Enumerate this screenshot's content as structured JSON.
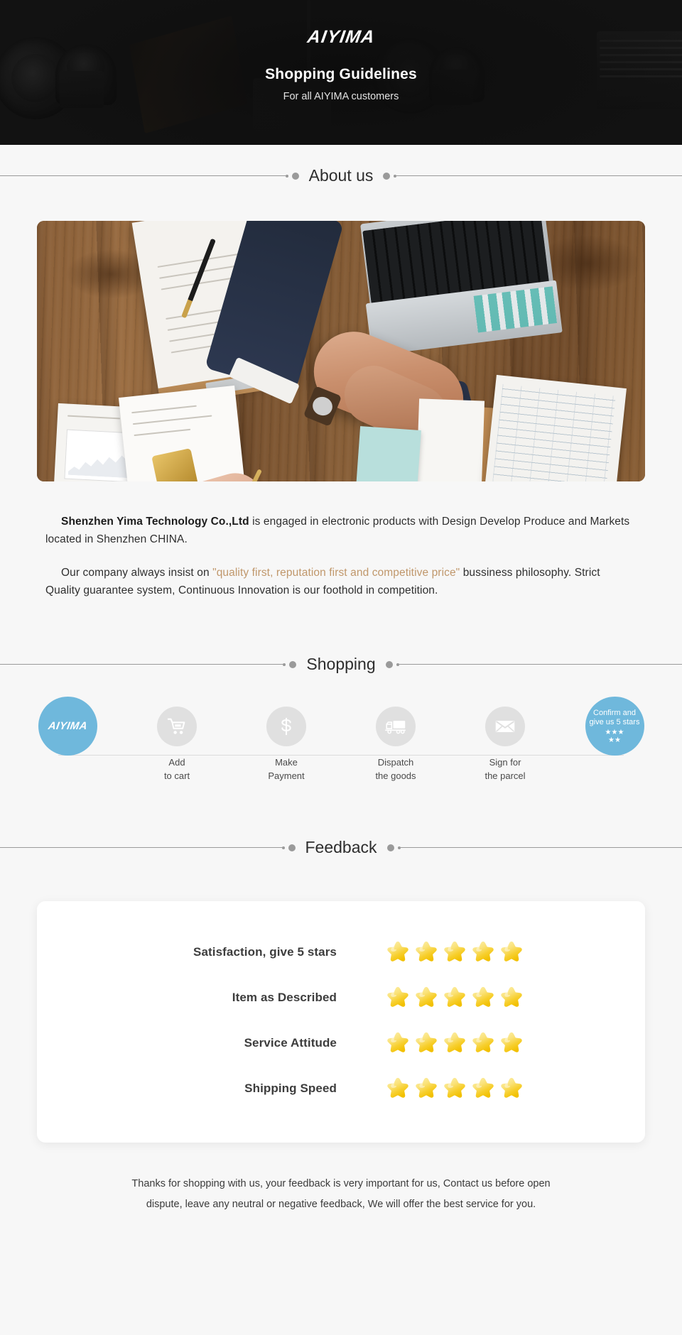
{
  "banner": {
    "brand": "AIYIMA",
    "title": "Shopping Guidelines",
    "subtitle": "For all AIYIMA customers"
  },
  "sections": {
    "about": {
      "title": "About us"
    },
    "shopping": {
      "title": "Shopping"
    },
    "feedback": {
      "title": "Feedback"
    }
  },
  "about": {
    "hero_alt": "handshake-over-desk-photo",
    "paragraph1": {
      "company": "Shenzhen Yima Technology Co.,Ltd",
      "rest": " is engaged in electronic products with Design Develop Produce and Markets located in Shenzhen CHINA."
    },
    "paragraph2": {
      "lead": "Our company always insist on ",
      "quote": "\"quality first, reputation first and competitive price\"",
      "rest": " bussiness philosophy. Strict Quality guarantee system, Continuous Innovation is our foothold in competition."
    }
  },
  "shopping_steps": [
    {
      "icon": "aiyima-logo-icon",
      "brand": "AIYIMA",
      "label": "",
      "style": "brand"
    },
    {
      "icon": "shopping-cart-icon",
      "label": "Add\nto cart",
      "line1": "Add",
      "line2": "to cart",
      "style": "grey"
    },
    {
      "icon": "dollar-icon",
      "label": "Make\nPayment",
      "line1": "Make",
      "line2": "Payment",
      "style": "grey"
    },
    {
      "icon": "delivery-truck-icon",
      "label": "Dispatch\nthe goods",
      "line1": "Dispatch",
      "line2": "the goods",
      "style": "grey"
    },
    {
      "icon": "envelope-icon",
      "label": "Sign for\nthe parcel",
      "line1": "Sign for",
      "line2": "the parcel",
      "style": "grey"
    },
    {
      "icon": "five-stars-icon",
      "confirm_line1": "Confirm and",
      "confirm_line2": "give us 5 stars",
      "stars_top": "★★★",
      "stars_bottom": "★★",
      "style": "blue"
    }
  ],
  "feedback": {
    "rows": [
      {
        "label": "Satisfaction, give 5 stars",
        "stars": 5
      },
      {
        "label": "Item as Described",
        "stars": 5
      },
      {
        "label": "Service Attitude",
        "stars": 5
      },
      {
        "label": "Shipping Speed",
        "stars": 5
      }
    ],
    "note_line1": "Thanks for shopping with us, your feedback is very important for us, Contact us before open",
    "note_line2": "dispute, leave any neutral or negative feedback, We will offer the best service for you."
  },
  "colors": {
    "brand_blue": "#6fb8dc",
    "quote_tan": "#c0976b",
    "banner_bg": "#121212",
    "page_bg": "#f7f7f7",
    "star_gold": "#f5d13a",
    "step_grey": "#e0e0e0"
  }
}
